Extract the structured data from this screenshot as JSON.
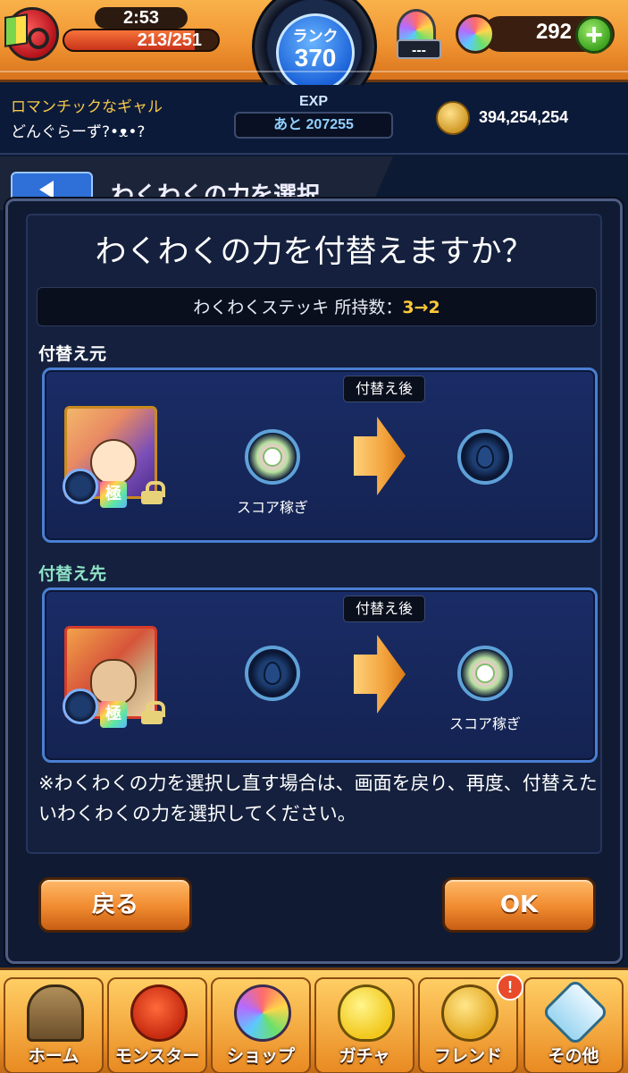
{
  "header": {
    "stamina_timer": "2:53",
    "stamina": "213/251",
    "stamina_fraction": 0.85,
    "rank_label": "ランク",
    "rank_value": "370",
    "orb_counter_text": "---",
    "gem_count": "292"
  },
  "status": {
    "user_title": "ロマンチックなギャル",
    "user_name": "どんぐらーず?•ᴥ•?",
    "exp_label": "EXP",
    "exp_remaining": "あと 207255",
    "coins": "394,254,254"
  },
  "background_screen": {
    "title": "わくわくの力を選択"
  },
  "dialog": {
    "title": "わくわくの力を付替えますか？",
    "stock_label": "わくわくステッキ 所持数：",
    "stock_change": "3→2",
    "source_label": "付替え元",
    "target_label": "付替え先",
    "after_tag": "付替え後",
    "ultra_badge": "極",
    "source": {
      "current_ability": "スコア稼ぎ",
      "after_ability": ""
    },
    "target": {
      "current_ability": "",
      "after_ability": "スコア稼ぎ"
    },
    "note": "※わくわくの力を選択し直す場合は、画面を戻り、再度、付替えたいわくわくの力を選択してください。",
    "back_button": "戻る",
    "ok_button": "OK"
  },
  "bottom_nav": {
    "items": [
      {
        "label": "ホーム",
        "icon": "home-icon"
      },
      {
        "label": "モンスター",
        "icon": "monster-icon"
      },
      {
        "label": "ショップ",
        "icon": "shop-icon"
      },
      {
        "label": "ガチャ",
        "icon": "gacha-icon"
      },
      {
        "label": "フレンド",
        "icon": "friend-icon"
      },
      {
        "label": "その他",
        "icon": "other-icon"
      }
    ],
    "friend_alert": "!"
  },
  "colors": {
    "accent_orange": "#f09432",
    "stock_highlight": "#ffc83a",
    "target_label": "#8fe2c6",
    "panel_border": "#4a7fd2"
  }
}
